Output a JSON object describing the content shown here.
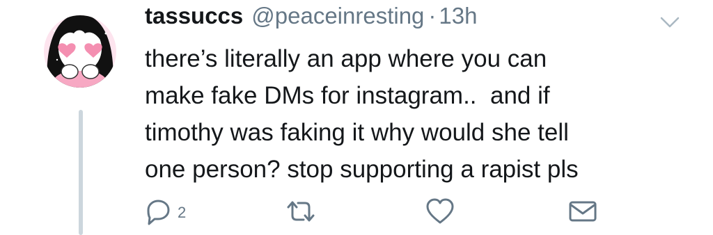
{
  "tweet": {
    "display_name": "tassuccs",
    "handle": "@peaceinresting",
    "separator": "·",
    "time": "13h",
    "text_lines": [
      "there’s literally an app where you can",
      "make fake DMs for instagram..  and if",
      "timothy was faking it why would she tell",
      "one person? stop supporting a rapist pls"
    ],
    "avatar_icon": "avatar-illustration",
    "caret_icon": "chevron-down-icon"
  },
  "actions": {
    "reply": {
      "icon": "reply-icon",
      "count": "2"
    },
    "retweet": {
      "icon": "retweet-icon"
    },
    "like": {
      "icon": "heart-icon"
    },
    "dm": {
      "icon": "envelope-icon"
    }
  },
  "colors": {
    "text": "#14171a",
    "secondary": "#657786",
    "thread_line": "#ccd6dd",
    "avatar_bg": "#fde4ee"
  }
}
